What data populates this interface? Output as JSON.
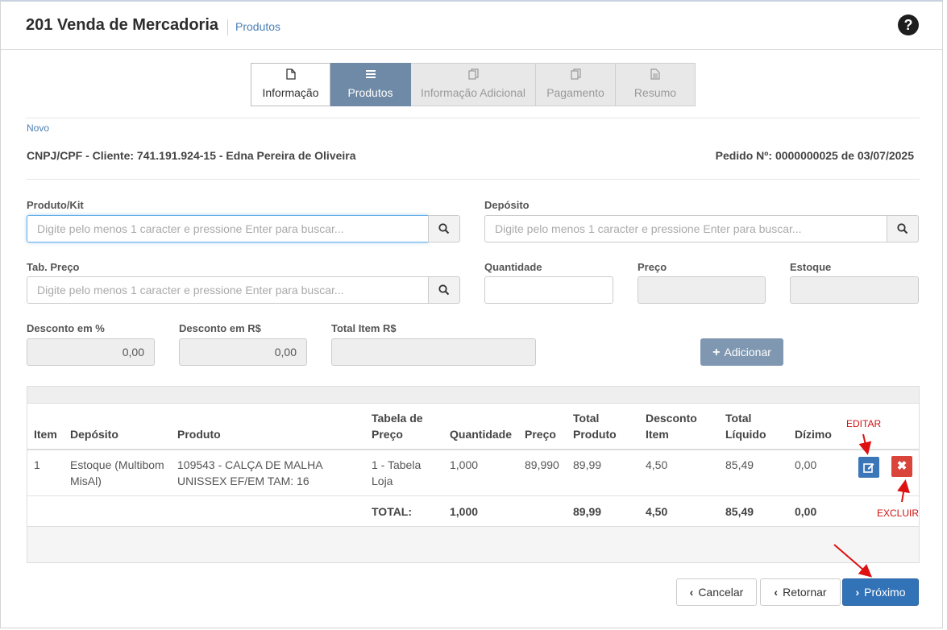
{
  "header": {
    "title": "201 Venda de Mercadoria",
    "breadcrumb": "Produtos",
    "help_icon": "question-circle"
  },
  "wizard": {
    "steps": [
      {
        "label": "Informação",
        "icon": "file-icon",
        "state": "done"
      },
      {
        "label": "Produtos",
        "icon": "list-icon",
        "state": "active"
      },
      {
        "label": "Informação Adicional",
        "icon": "copy-icon",
        "state": "disabled"
      },
      {
        "label": "Pagamento",
        "icon": "copy-icon",
        "state": "disabled"
      },
      {
        "label": "Resumo",
        "icon": "document-icon",
        "state": "disabled"
      }
    ]
  },
  "novo_link": "Novo",
  "client_info": "CNPJ/CPF - Cliente: 741.191.924-15 - Edna Pereira de Oliveira",
  "order_info": "Pedido Nº: 0000000025 de 03/07/2025",
  "form": {
    "produto_label": "Produto/Kit",
    "produto_placeholder": "Digite pelo menos 1 caracter e pressione Enter para buscar...",
    "deposito_label": "Depósito",
    "deposito_placeholder": "Digite pelo menos 1 caracter e pressione Enter para buscar...",
    "tabpreco_label": "Tab. Preço",
    "tabpreco_placeholder": "Digite pelo menos 1 caracter e pressione Enter para buscar...",
    "quantidade_label": "Quantidade",
    "quantidade_value": "",
    "preco_label": "Preço",
    "preco_value": "",
    "estoque_label": "Estoque",
    "estoque_value": "",
    "desc_pct_label": "Desconto em %",
    "desc_pct_value": "0,00",
    "desc_rs_label": "Desconto em R$",
    "desc_rs_value": "0,00",
    "total_item_label": "Total Item R$",
    "total_item_value": "",
    "add_button": "Adicionar"
  },
  "table": {
    "headers": {
      "item": "Item",
      "deposito": "Depósito",
      "produto": "Produto",
      "tabela_1": "Tabela de",
      "tabela_2": "Preço",
      "quantidade": "Quantidade",
      "preco": "Preço",
      "total_produto_1": "Total",
      "total_produto_2": "Produto",
      "desconto_1": "Desconto",
      "desconto_2": "Item",
      "total_liquido_1": "Total",
      "total_liquido_2": "Líquido",
      "dizimo": "Dízimo"
    },
    "rows": [
      {
        "item": "1",
        "deposito_1": "Estoque (Multibom",
        "deposito_2": "MisAl)",
        "produto_1": "109543 - CALÇA DE MALHA",
        "produto_2": "UNISSEX EF/EM TAM: 16",
        "tabela_1": "1 - Tabela",
        "tabela_2": "Loja",
        "quantidade": "1,000",
        "preco": "89,990",
        "total_produto": "89,99",
        "desconto": "4,50",
        "total_liquido": "85,49",
        "dizimo": "0,00"
      }
    ],
    "footer": {
      "label": "TOTAL:",
      "quantidade": "1,000",
      "total_produto": "89,99",
      "desconto": "4,50",
      "total_liquido": "85,49",
      "dizimo": "0,00"
    }
  },
  "annotations": {
    "editar": "EDITAR",
    "excluir": "EXCLUIR",
    "color": "#cc1111"
  },
  "footer_buttons": {
    "cancelar": "Cancelar",
    "retornar": "Retornar",
    "proximo": "Próximo"
  },
  "colors": {
    "primary": "#3273b8",
    "active_step": "#6f8aa6",
    "add_button": "#7f97b0",
    "delete": "#d9443b",
    "link": "#4a7fb5"
  }
}
